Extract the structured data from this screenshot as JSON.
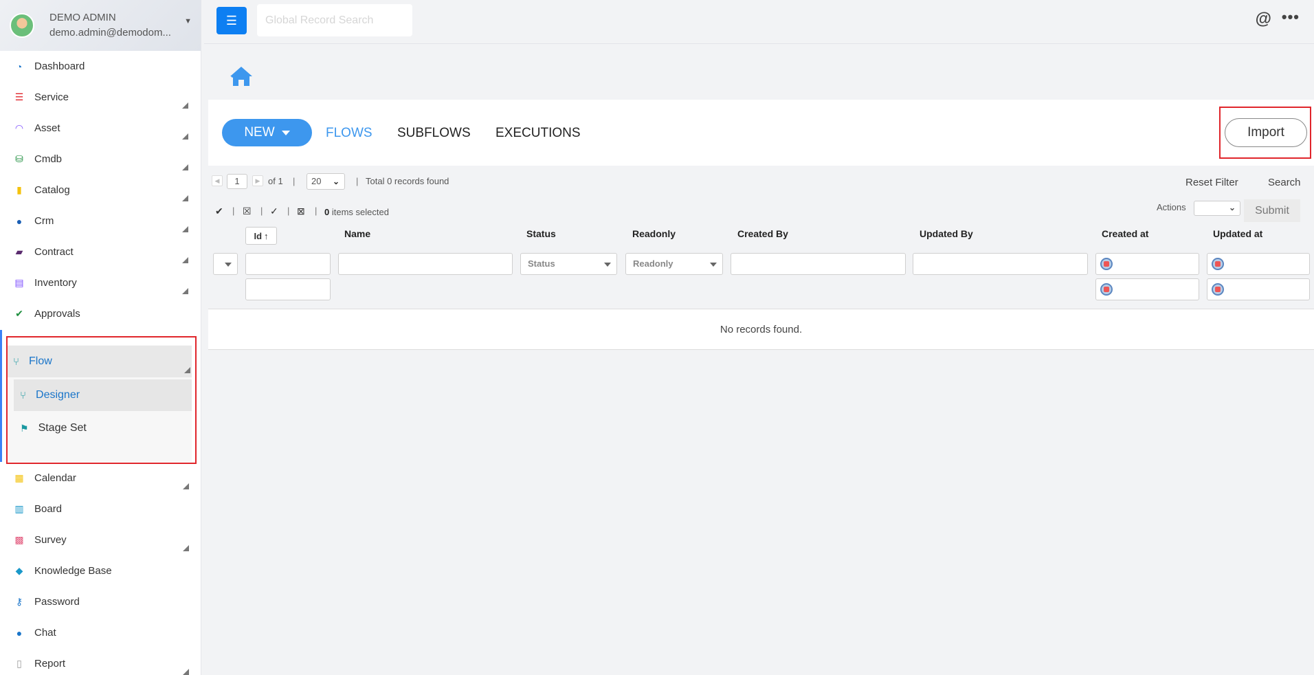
{
  "user": {
    "name": "DEMO ADMIN",
    "email": "demo.admin@demodom..."
  },
  "sidebar": {
    "items": [
      {
        "label": "Dashboard",
        "icon": "dashboard-icon",
        "color": "#1a75c9"
      },
      {
        "label": "Service",
        "icon": "list-icon",
        "color": "#e0252b"
      },
      {
        "label": "Asset",
        "icon": "wifi-icon",
        "color": "#7c4dff"
      },
      {
        "label": "Cmdb",
        "icon": "database-icon",
        "color": "#1e8e3e"
      },
      {
        "label": "Catalog",
        "icon": "clipboard-icon",
        "color": "#f4c20d"
      },
      {
        "label": "Crm",
        "icon": "users-icon",
        "color": "#1a5fb4"
      },
      {
        "label": "Contract",
        "icon": "scroll-icon",
        "color": "#5b2c6f"
      },
      {
        "label": "Inventory",
        "icon": "warehouse-icon",
        "color": "#7c4dff"
      },
      {
        "label": "Approvals",
        "icon": "check-circle-icon",
        "color": "#1e8e3e"
      }
    ],
    "flow": {
      "label": "Flow",
      "designer": "Designer",
      "stage_set": "Stage Set"
    },
    "items_after": [
      {
        "label": "Calendar",
        "icon": "calendar-icon",
        "color": "#f4c20d"
      },
      {
        "label": "Board",
        "icon": "board-icon",
        "color": "#1a98c9"
      },
      {
        "label": "Survey",
        "icon": "chart-icon",
        "color": "#e2557a"
      },
      {
        "label": "Knowledge Base",
        "icon": "reader-icon",
        "color": "#1a98c9"
      },
      {
        "label": "Password",
        "icon": "key-icon",
        "color": "#1a75c9"
      },
      {
        "label": "Chat",
        "icon": "chat-icon",
        "color": "#1a75c9"
      },
      {
        "label": "Report",
        "icon": "report-icon",
        "color": "#999999"
      }
    ]
  },
  "topbar": {
    "search_placeholder": "Global Record Search",
    "at_icon": "@",
    "more_icon": "•••"
  },
  "toolbar": {
    "new_label": "NEW",
    "tabs": [
      "FLOWS",
      "SUBFLOWS",
      "EXECUTIONS"
    ],
    "import_label": "Import"
  },
  "pager": {
    "page": "1",
    "of": "of 1",
    "page_size": "20",
    "total": "Total 0 records found",
    "reset_filter": "Reset Filter",
    "search": "Search"
  },
  "bulk": {
    "selected_count": "0",
    "selected_suffix": " items selected",
    "actions_label": "Actions",
    "submit": "Submit"
  },
  "table": {
    "columns": [
      "Id",
      "Name",
      "Status",
      "Readonly",
      "Created By",
      "Updated By",
      "Created at",
      "Updated at"
    ],
    "status_placeholder": "Status",
    "readonly_placeholder": "Readonly",
    "empty_message": "No records found."
  }
}
